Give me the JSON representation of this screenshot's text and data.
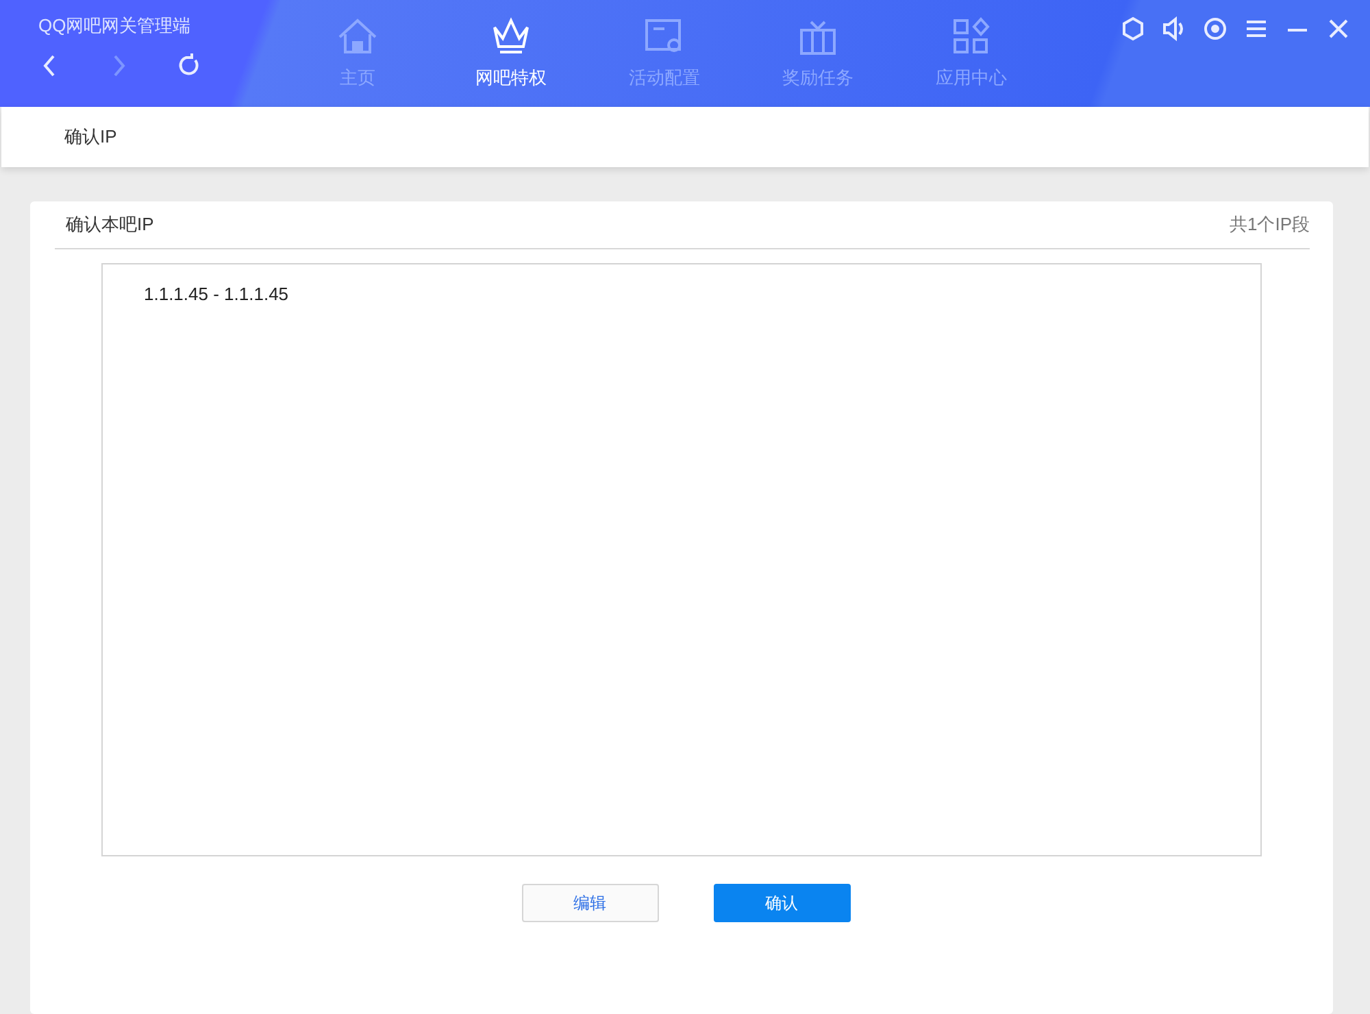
{
  "app_title": "QQ网吧网关管理端",
  "nav_controls": [
    {
      "kind": "back",
      "disabled": false
    },
    {
      "kind": "forward",
      "disabled": true
    },
    {
      "kind": "refresh",
      "disabled": false
    }
  ],
  "tabs": [
    {
      "label": "主页",
      "selected": false
    },
    {
      "label": "网吧特权",
      "selected": true
    },
    {
      "label": "活动配置",
      "selected": false
    },
    {
      "label": "奖励任务",
      "selected": false
    },
    {
      "label": "应用中心",
      "selected": false
    }
  ],
  "breadcrumb": "确认IP",
  "panel": {
    "title": "确认本吧IP",
    "count": "共1个IP段",
    "ip_ranges": [
      "1.1.1.45 - 1.1.1.45"
    ]
  },
  "buttons": [
    {
      "label": "编辑",
      "kind": "secondary"
    },
    {
      "label": "确认",
      "kind": "primary"
    }
  ]
}
